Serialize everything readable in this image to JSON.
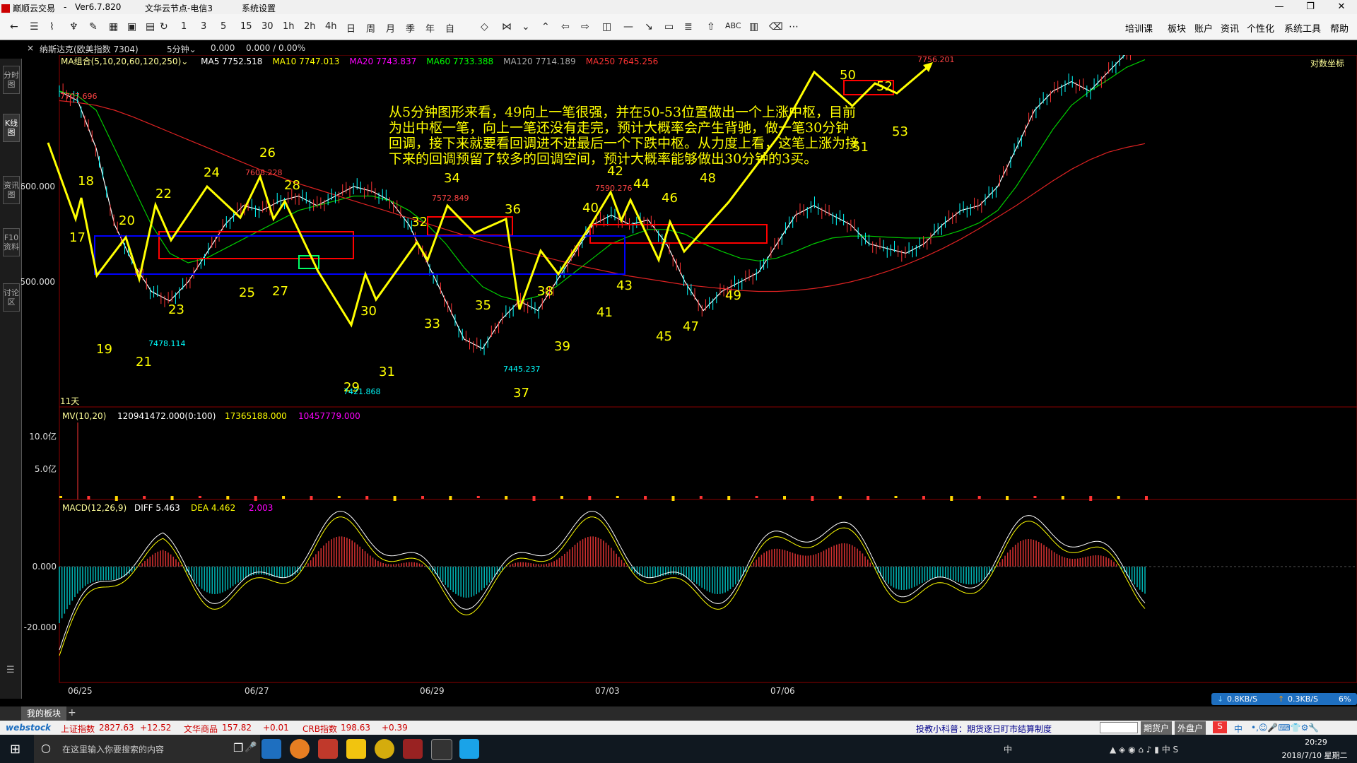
{
  "app": {
    "title": "巅顺云交易",
    "version": "Ver6.7.820",
    "server": "文华云节点-电信3",
    "menu_item": "系统设置"
  },
  "toolbar": {
    "periods": [
      "1",
      "3",
      "5",
      "15",
      "30",
      "1h",
      "2h",
      "4h",
      "日",
      "周",
      "月",
      "季",
      "年",
      "自"
    ],
    "right_menu": [
      "培训课",
      "板块",
      "账户",
      "资讯",
      "个性化",
      "系统工具",
      "帮助"
    ]
  },
  "left_tabs": [
    "分时图",
    "K线图",
    "资讯图",
    "F10资料",
    "讨论区"
  ],
  "chart_header": {
    "instrument": "纳斯达克(欧美指数 7304)",
    "period": "5分钟",
    "last": "0.000",
    "change": "0.000 / 0.00%"
  },
  "ma_legend": {
    "label": "MA组合(5,10,20,60,120,250)",
    "items": [
      {
        "text": "MA5 7752.518",
        "color": "#ffffff"
      },
      {
        "text": "MA10 7747.013",
        "color": "#ffff00"
      },
      {
        "text": "MA20 7743.837",
        "color": "#ff00ff"
      },
      {
        "text": "MA60 7733.388",
        "color": "#00ff00"
      },
      {
        "text": "MA120 7714.189",
        "color": "#aaaaaa"
      },
      {
        "text": "MA250 7645.256",
        "color": "#ff3333"
      }
    ]
  },
  "log_axis_label": "对数坐标",
  "price_axis": [
    "7600.000",
    "7500.000"
  ],
  "price_marks": [
    {
      "label": "7707.696",
      "color": "#ff4444"
    },
    {
      "label": "7478.114",
      "color": "#00ffff"
    },
    {
      "label": "7608.228",
      "color": "#ff4444"
    },
    {
      "label": "7421.868",
      "color": "#00ffff"
    },
    {
      "label": "7572.849",
      "color": "#ff4444"
    },
    {
      "label": "7445.237",
      "color": "#00ffff"
    },
    {
      "label": "7590.276",
      "color": "#ff4444"
    },
    {
      "label": "7756.201",
      "color": "#ff4444"
    }
  ],
  "annotation": "从5分钟图形来看，49向上一笔很强，并在50-53位置做出一个上涨中枢，目前为出中枢一笔，向上一笔还没有走完，预计大概率会产生背驰，做一笔30分钟回调，接下来就要看回调进不进最后一个下跌中枢。从力度上看，这笔上涨为接下来的回调预留了较多的回调空间，预计大概率能够做出30分钟的3买。",
  "day_count": "11天",
  "wave_labels": [
    "17",
    "18",
    "19",
    "20",
    "21",
    "22",
    "23",
    "24",
    "25",
    "26",
    "27",
    "28",
    "29",
    "30",
    "31",
    "32",
    "33",
    "34",
    "35",
    "36",
    "37",
    "38",
    "39",
    "40",
    "41",
    "42",
    "43",
    "44",
    "45",
    "46",
    "47",
    "48",
    "49",
    "50",
    "51",
    "52",
    "53"
  ],
  "volume_panel": {
    "label": "MV(10,20)",
    "values": [
      "120941472.000(0:100)",
      "17365188.000",
      "10457779.000"
    ],
    "axis": [
      "10.0亿",
      "5.0亿"
    ]
  },
  "macd_panel": {
    "label": "MACD(12,26,9)",
    "diff": "DIFF 5.463",
    "dea": "DEA 4.462",
    "macd": "2.003",
    "axis": [
      "0.000",
      "-20.000"
    ]
  },
  "dates": [
    "06/25",
    "06/27",
    "06/29",
    "07/03",
    "07/06"
  ],
  "net": {
    "down": "0.8KB/S",
    "up": "0.3KB/S",
    "pct": "6%"
  },
  "bottom_tab": "我的板块",
  "bottom_add": "+",
  "ticker": {
    "brand": "webstock",
    "items": [
      {
        "name": "上证指数",
        "value": "2827.63",
        "chg": "+12.52"
      },
      {
        "name": "文华商品",
        "value": "157.82",
        "chg": "+0.01"
      },
      {
        "name": "CRB指数",
        "value": "198.63",
        "chg": "+0.39"
      }
    ],
    "tip": "投教小科普：期货逐日盯市结算制度",
    "btn_futures": "期货户",
    "btn_forex": "外盘户",
    "ime": "中"
  },
  "taskbar": {
    "search_placeholder": "在这里输入你要搜索的内容",
    "time": "20:29",
    "date": "2018/7/10 星期二",
    "lang": "中"
  },
  "chart_data": {
    "type": "line",
    "x_ticks": [
      "06/25",
      "06/27",
      "06/29",
      "07/03",
      "07/06"
    ],
    "y_ticks": [
      7500,
      7600
    ],
    "series": [
      {
        "name": "MA5",
        "values": [
          7700,
          7690,
          7640,
          7560,
          7520,
          7490,
          7480,
          7500,
          7530,
          7560,
          7580,
          7575,
          7585,
          7590,
          7580,
          7590,
          7600,
          7595,
          7585,
          7560,
          7520,
          7480,
          7440,
          7430,
          7460,
          7480,
          7470,
          7500,
          7530,
          7560,
          7570,
          7560,
          7565,
          7540,
          7500,
          7470,
          7490,
          7500,
          7510,
          7540,
          7570,
          7580,
          7570,
          7560,
          7540,
          7535,
          7530,
          7540,
          7560,
          7575,
          7580,
          7600,
          7640,
          7680,
          7700,
          7710,
          7700,
          7720,
          7740,
          7750
        ]
      },
      {
        "name": "MA60",
        "values": [
          7700,
          7695,
          7680,
          7640,
          7600,
          7560,
          7530,
          7520,
          7525,
          7535,
          7545,
          7555,
          7565,
          7575,
          7580,
          7585,
          7590,
          7590,
          7585,
          7575,
          7560,
          7540,
          7515,
          7495,
          7485,
          7480,
          7485,
          7495,
          7510,
          7525,
          7540,
          7548,
          7555,
          7555,
          7550,
          7540,
          7532,
          7525,
          7522,
          7525,
          7532,
          7540,
          7546,
          7548,
          7548,
          7547,
          7546,
          7546,
          7548,
          7554,
          7562,
          7575,
          7600,
          7630,
          7660,
          7685,
          7700,
          7712,
          7725,
          7733
        ]
      },
      {
        "name": "MA250",
        "values": [
          7690,
          7688,
          7685,
          7680,
          7673,
          7665,
          7657,
          7649,
          7641,
          7633,
          7625,
          7617,
          7610,
          7603,
          7597,
          7591,
          7585,
          7579,
          7573,
          7567,
          7561,
          7555,
          7549,
          7543,
          7538,
          7533,
          7528,
          7523,
          7518,
          7514,
          7510,
          7506,
          7503,
          7500,
          7497,
          7495,
          7493,
          7491,
          7490,
          7490,
          7491,
          7493,
          7496,
          7500,
          7505,
          7511,
          7518,
          7526,
          7535,
          7545,
          7556,
          7568,
          7580,
          7593,
          7606,
          7618,
          7628,
          7636,
          7641,
          7645
        ]
      }
    ]
  }
}
